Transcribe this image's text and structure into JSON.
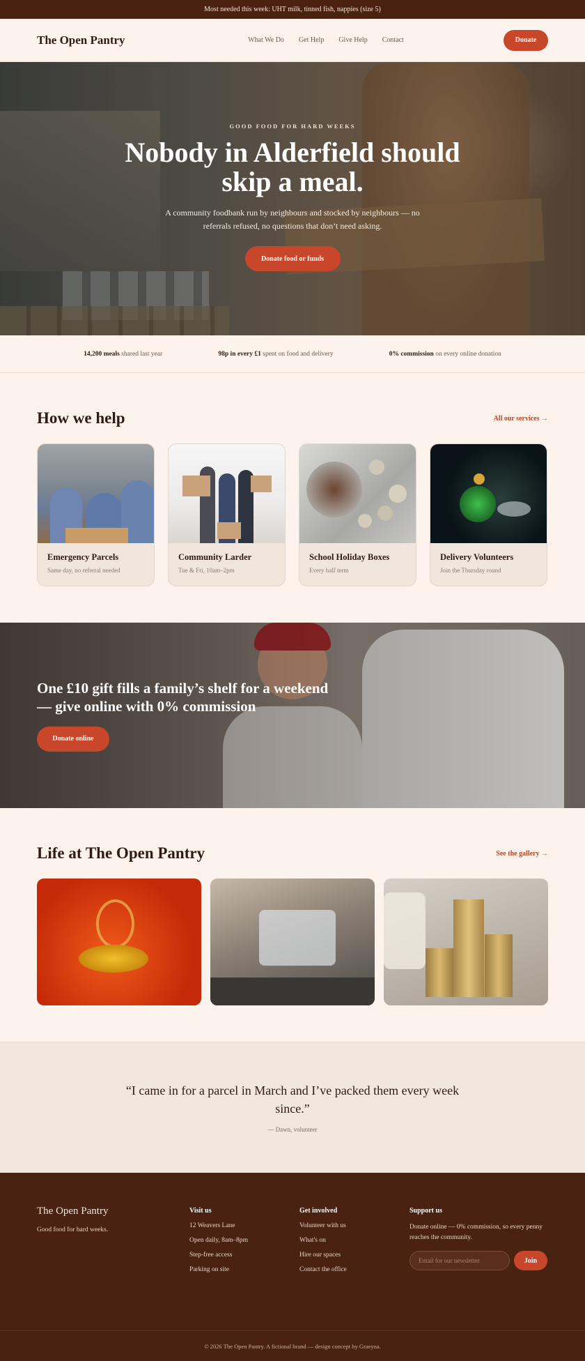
{
  "announcement": "Most needed this week: UHT milk, tinned fish, nappies (size 5)",
  "header": {
    "logo": "The Open Pantry",
    "nav": [
      "What We Do",
      "Get Help",
      "Give Help",
      "Contact"
    ],
    "donate_label": "Donate"
  },
  "hero": {
    "eyebrow": "GOOD FOOD FOR HARD WEEKS",
    "title": "Nobody in Alderfield should skip a meal.",
    "subtitle": "A community foodbank run by neighbours and stocked by neighbours — no referrals refused, no questions that don’t need asking.",
    "cta_label": "Donate food or funds"
  },
  "stats": [
    {
      "bold": "14,200 meals",
      "rest": " shared last year"
    },
    {
      "bold": "98p in every £1",
      "rest": " spent on food and delivery"
    },
    {
      "bold": "0% commission",
      "rest": " on every online donation"
    }
  ],
  "help": {
    "title": "How we help",
    "link": "All our services →",
    "cards": [
      {
        "title": "Emergency Parcels",
        "sub": "Same day, no referral needed"
      },
      {
        "title": "Community Larder",
        "sub": "Tue & Fri, 10am–2pm"
      },
      {
        "title": "School Holiday Boxes",
        "sub": "Every half term"
      },
      {
        "title": "Delivery Volunteers",
        "sub": "Join the Thursday round"
      }
    ]
  },
  "cta": {
    "title": "One £10 gift fills a family’s shelf for a weekend — give online with 0% commission",
    "button": "Donate online"
  },
  "life": {
    "title": "Life at The Open Pantry",
    "link": "See the gallery →"
  },
  "quote": {
    "text": "“I came in for a parcel in March and I’ve packed them every week since.”",
    "cite": "— Dawn, volunteer"
  },
  "footer": {
    "logo": "The Open Pantry",
    "tagline": "Good food for hard weeks.",
    "visit": {
      "title": "Visit us",
      "items": [
        "12 Weavers Lane",
        "Open daily, 8am–8pm",
        "Step-free access",
        "Parking on site"
      ]
    },
    "involved": {
      "title": "Get involved",
      "items": [
        "Volunteer with us",
        "What's on",
        "Hire our spaces",
        "Contact the office"
      ]
    },
    "support": {
      "title": "Support us",
      "text": "Donate online — 0% commission, so every penny reaches the community.",
      "placeholder": "Email for our newsletter",
      "join": "Join"
    },
    "copyright": "© 2026 The Open Pantry. A fictional brand — design concept by Graeyna."
  }
}
